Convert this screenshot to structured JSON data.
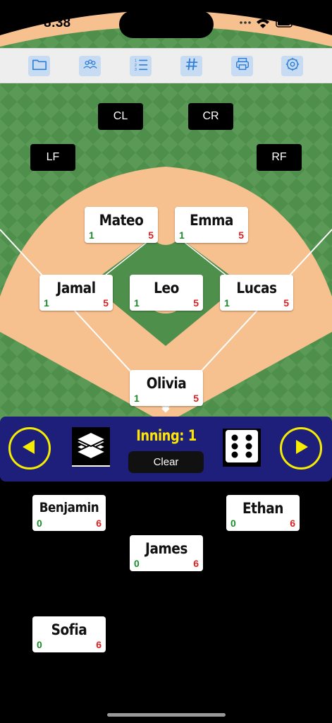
{
  "status_bar": {
    "time": "8:38"
  },
  "toolbar": {
    "buttons": [
      {
        "icon": "folder-icon"
      },
      {
        "icon": "people-icon"
      },
      {
        "icon": "numbered-list-icon"
      },
      {
        "icon": "hash-icon"
      },
      {
        "icon": "printer-icon"
      },
      {
        "icon": "settings-gear-icon"
      }
    ]
  },
  "positions": {
    "cl": "CL",
    "cr": "CR",
    "lf": "LF",
    "rf": "RF"
  },
  "field_players": [
    {
      "name": "Mateo",
      "low": "1",
      "high": "5"
    },
    {
      "name": "Emma",
      "low": "1",
      "high": "5"
    },
    {
      "name": "Jamal",
      "low": "1",
      "high": "5"
    },
    {
      "name": "Leo",
      "low": "1",
      "high": "5"
    },
    {
      "name": "Lucas",
      "low": "1",
      "high": "5"
    },
    {
      "name": "Olivia",
      "low": "1",
      "high": "5"
    }
  ],
  "controls": {
    "inning_label": "Inning: 1",
    "clear_label": "Clear"
  },
  "bench_players": [
    {
      "name": "Benjamin",
      "low": "0",
      "high": "6"
    },
    {
      "name": "Ethan",
      "low": "0",
      "high": "6"
    },
    {
      "name": "James",
      "low": "0",
      "high": "6"
    },
    {
      "name": "Sofia",
      "low": "0",
      "high": "6"
    }
  ],
  "colors": {
    "grass": "#4f8f4c",
    "grass_light": "#5c9c58",
    "dirt": "#f7c08f",
    "control_bar": "#1e1f7a",
    "accent_yellow": "#f5ec00",
    "toolbar_button": "#c7dcf3",
    "icon_blue": "#2f7fd6"
  }
}
